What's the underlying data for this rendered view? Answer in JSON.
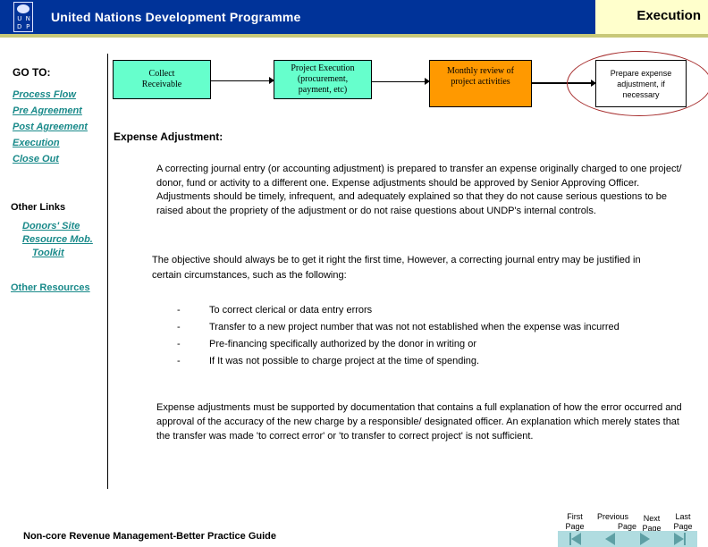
{
  "header": {
    "org_name": "United Nations Development Programme",
    "logo_letters": [
      "U",
      "N",
      "D",
      "P"
    ],
    "section": "Execution",
    "colors": {
      "banner": "#003399",
      "stripe": "#c8c878",
      "section_tab": "#ffffcc"
    }
  },
  "sidebar": {
    "goto_label": "GO TO:",
    "nav_links": [
      {
        "label": "Process Flow"
      },
      {
        "label": "Pre Agreement"
      },
      {
        "label": "Post Agreement"
      },
      {
        "label": "Execution"
      },
      {
        "label": "Close Out"
      }
    ],
    "other_links_label": "Other Links",
    "other_links": [
      {
        "label": "Donors' Site"
      },
      {
        "label": "Resource Mob."
      },
      {
        "label": "Toolkit"
      }
    ],
    "other_resources": "Other Resources",
    "link_color": "#1a8a8a"
  },
  "flow": {
    "steps": [
      {
        "label_line1": "Collect",
        "label_line2": "Receivable",
        "color": "#66ffcc"
      },
      {
        "label_line1": "Project Execution",
        "label_line2": "(procurement,",
        "label_line3": "payment, etc)",
        "color": "#66ffcc"
      },
      {
        "label_line1": "Monthly review of",
        "label_line2": "project activities",
        "color": "#ff9900"
      },
      {
        "label_line1": "Prepare expense",
        "label_line2": "adjustment, if",
        "label_line3": "necessary",
        "color": "#ffffff",
        "highlighted": true
      }
    ]
  },
  "content": {
    "heading": "Expense Adjustment:",
    "para1": "A correcting journal entry (or accounting adjustment) is prepared to transfer an expense originally charged to one project/ donor, fund or activity to a different one.  Expense adjustments should be approved by Senior Approving Officer.  Adjustments should be timely, infrequent, and adequately explained so that they do not cause serious questions to be raised about the propriety  of the adjustment  or do not raise questions about UNDP's internal controls.",
    "para2": "The objective should always be to get it right the first time,  However, a correcting journal entry may be justified in certain circumstances, such as the following:",
    "bullet_marker": "-",
    "bullets": [
      "To correct clerical or  data entry errors",
      "Transfer to a  new project number that was not not established when the expense was incurred",
      "Pre-financing specifically authorized by the donor in writing or",
      "If It was not possible to charge project at the time of spending."
    ],
    "para3": "Expense adjustments must be supported by documentation that contains a full explanation of how the error occurred and approval of the accuracy of the new charge by a responsible/ designated officer.  An explanation which merely states that the transfer was made 'to correct error' or 'to transfer to correct project' is not sufficient."
  },
  "footer": {
    "title": "Non-core Revenue Management-Better Practice Guide",
    "nav": [
      {
        "line1": "First",
        "line2": "Page",
        "icon": "first-page-icon"
      },
      {
        "line1": "Previous",
        "line2": "Page",
        "icon": "previous-page-icon"
      },
      {
        "line1": "Next",
        "line2": "Page",
        "icon": "next-page-icon"
      },
      {
        "line1": "Last",
        "line2": "Page",
        "icon": "last-page-icon"
      }
    ],
    "nav_bar_color": "#b0dce0"
  }
}
